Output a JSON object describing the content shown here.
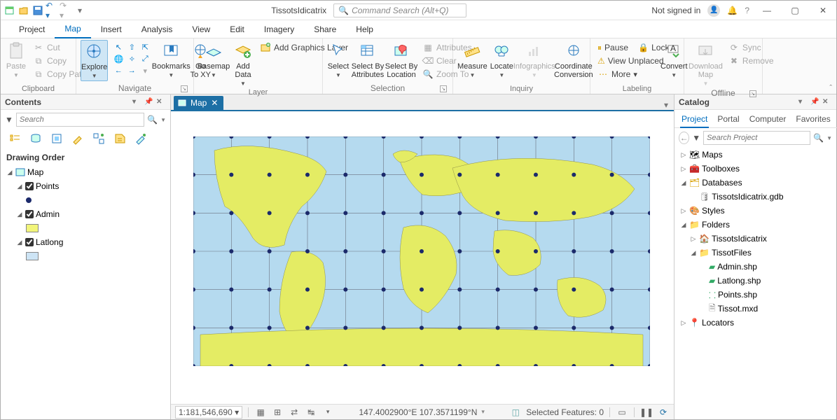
{
  "title": "TissotsIdicatrix",
  "command_search_placeholder": "Command Search (Alt+Q)",
  "signin": "Not signed in",
  "tabs": {
    "project": "Project",
    "map": "Map",
    "insert": "Insert",
    "analysis": "Analysis",
    "view": "View",
    "edit": "Edit",
    "imagery": "Imagery",
    "share": "Share",
    "help": "Help"
  },
  "ribbon": {
    "clipboard": {
      "label": "Clipboard",
      "paste": "Paste",
      "cut": "Cut",
      "copy": "Copy",
      "copypath": "Copy Path"
    },
    "navigate": {
      "label": "Navigate",
      "explore": "Explore",
      "bookmarks": "Bookmarks",
      "gotoxy": "Go\nTo XY"
    },
    "layer": {
      "label": "Layer",
      "basemap": "Basemap",
      "adddata": "Add\nData",
      "addgraphics": "Add Graphics Layer"
    },
    "selection": {
      "label": "Selection",
      "select": "Select",
      "select_attr": "Select By\nAttributes",
      "select_loc": "Select By\nLocation",
      "attributes": "Attributes",
      "clear": "Clear",
      "zoomto": "Zoom To"
    },
    "inquiry": {
      "label": "Inquiry",
      "measure": "Measure",
      "locate": "Locate",
      "infographics": "Infographics",
      "coord": "Coordinate\nConversion"
    },
    "labeling": {
      "label": "Labeling",
      "convert": "Convert",
      "pause": "Pause",
      "viewunplaced": "View Unplaced",
      "more": "More",
      "lock": "Lock"
    },
    "offline": {
      "label": "Offline",
      "download": "Download\nMap",
      "sync": "Sync",
      "remove": "Remove"
    }
  },
  "contents": {
    "title": "Contents",
    "search_placeholder": "Search",
    "section": "Drawing Order",
    "map_node": "Map",
    "layers": {
      "points": "Points",
      "admin": "Admin",
      "latlong": "Latlong"
    }
  },
  "catalog": {
    "title": "Catalog",
    "tabs": {
      "project": "Project",
      "portal": "Portal",
      "computer": "Computer",
      "favorites": "Favorites"
    },
    "search_placeholder": "Search Project",
    "nodes": {
      "maps": "Maps",
      "toolboxes": "Toolboxes",
      "databases": "Databases",
      "gdb": "TissotsIdicatrix.gdb",
      "styles": "Styles",
      "folders": "Folders",
      "f_tissots": "TissotsIdicatrix",
      "f_tissot": "TissotFiles",
      "admin": "Admin.shp",
      "latlong": "Latlong.shp",
      "points": "Points.shp",
      "tissotmxd": "Tissot.mxd",
      "locators": "Locators"
    }
  },
  "map_tab": "Map",
  "status": {
    "scale": "1:181,546,690",
    "coords": "147.4002900°E 107.3571199°N",
    "selected": "Selected Features: 0"
  }
}
